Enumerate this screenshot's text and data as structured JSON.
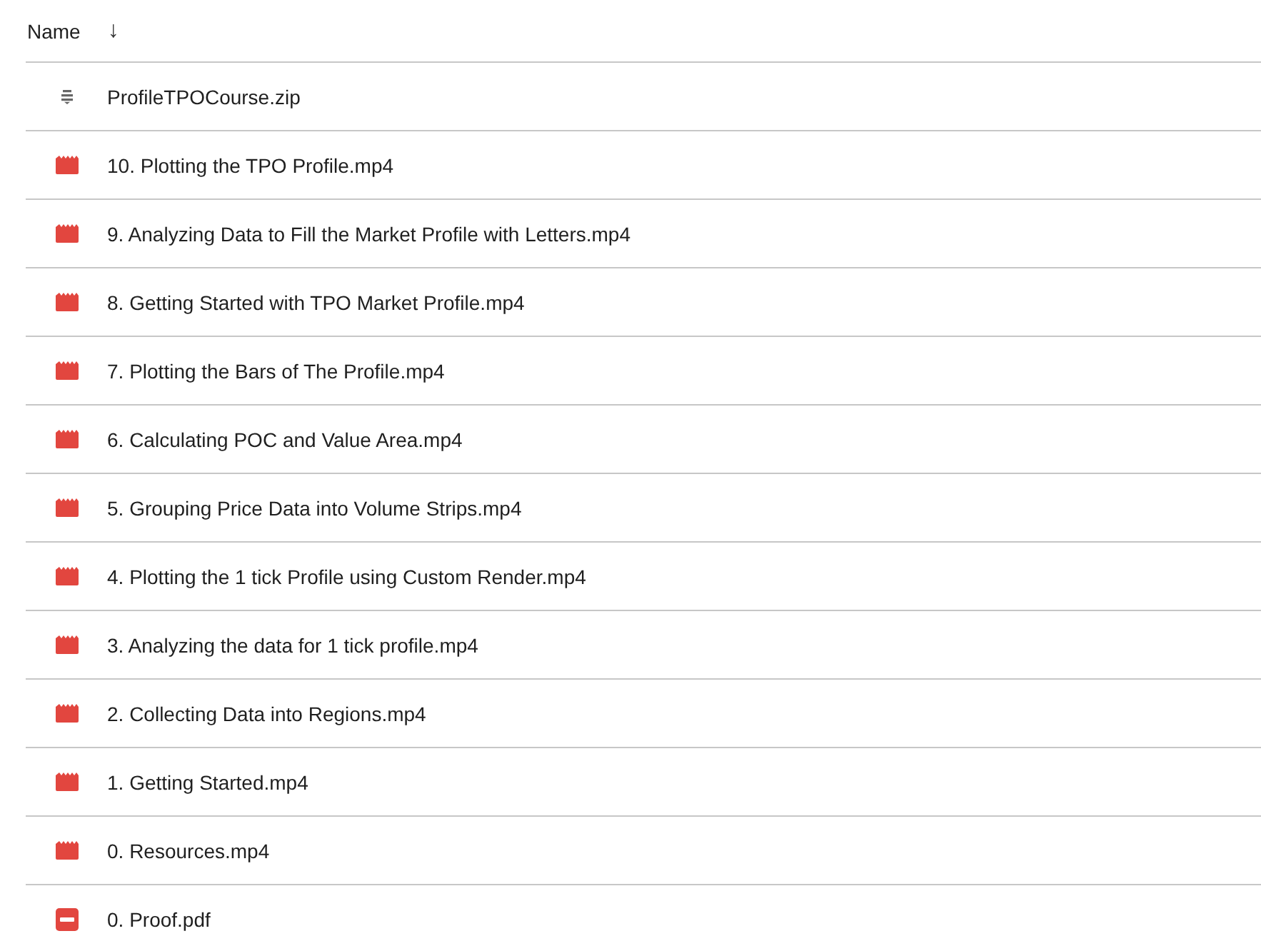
{
  "header": {
    "name_label": "Name",
    "sort_icon": "↓"
  },
  "files": [
    {
      "name": "ProfileTPOCourse.zip",
      "kind": "zip"
    },
    {
      "name": "10. Plotting the TPO Profile.mp4",
      "kind": "video"
    },
    {
      "name": "9. Analyzing Data to Fill the Market Profile with Letters.mp4",
      "kind": "video"
    },
    {
      "name": "8. Getting Started with TPO Market Profile.mp4",
      "kind": "video"
    },
    {
      "name": "7. Plotting the Bars of The Profile.mp4",
      "kind": "video"
    },
    {
      "name": "6. Calculating POC and Value Area.mp4",
      "kind": "video"
    },
    {
      "name": "5. Grouping Price Data into Volume Strips.mp4",
      "kind": "video"
    },
    {
      "name": "4. Plotting the 1 tick Profile using Custom Render.mp4",
      "kind": "video"
    },
    {
      "name": "3. Analyzing the data for 1 tick profile.mp4",
      "kind": "video"
    },
    {
      "name": "2. Collecting Data into Regions.mp4",
      "kind": "video"
    },
    {
      "name": "1. Getting Started.mp4",
      "kind": "video"
    },
    {
      "name": "0. Resources.mp4",
      "kind": "video"
    },
    {
      "name": "0. Proof.pdf",
      "kind": "pdf"
    }
  ]
}
